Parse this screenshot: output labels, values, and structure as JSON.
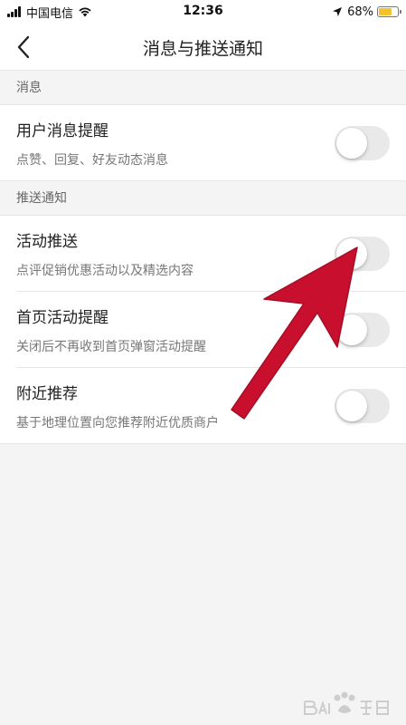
{
  "status_bar": {
    "carrier": "中国电信",
    "time": "12:36",
    "battery_percent": "68%",
    "battery_level": 0.68,
    "battery_color": "#f4c22b",
    "signal_icon": "cellular-signal-icon",
    "wifi_icon": "wifi-icon",
    "location_icon": "location-arrow-icon"
  },
  "header": {
    "title": "消息与推送通知",
    "back_icon": "chevron-left-icon"
  },
  "sections": [
    {
      "header": "消息",
      "items": [
        {
          "title": "用户消息提醒",
          "subtitle": "点赞、回复、好友动态消息",
          "enabled": false
        }
      ]
    },
    {
      "header": "推送通知",
      "items": [
        {
          "title": "活动推送",
          "subtitle": "点评促销优惠活动以及精选内容",
          "enabled": false
        },
        {
          "title": "首页活动提醒",
          "subtitle": "关闭后不再收到首页弹窗活动提醒",
          "enabled": false
        },
        {
          "title": "附近推荐",
          "subtitle": "基于地理位置向您推荐附近优质商户",
          "enabled": false
        }
      ]
    }
  ],
  "annotation": {
    "type": "arrow",
    "color": "#c8102e",
    "points_to": "活动推送"
  },
  "watermark": {
    "logo": "baidu-jingyan-logo"
  },
  "colors": {
    "background": "#f4f4f4",
    "toggle_off": "#e9e9ea",
    "text_primary": "#222222",
    "text_secondary": "#777777"
  }
}
